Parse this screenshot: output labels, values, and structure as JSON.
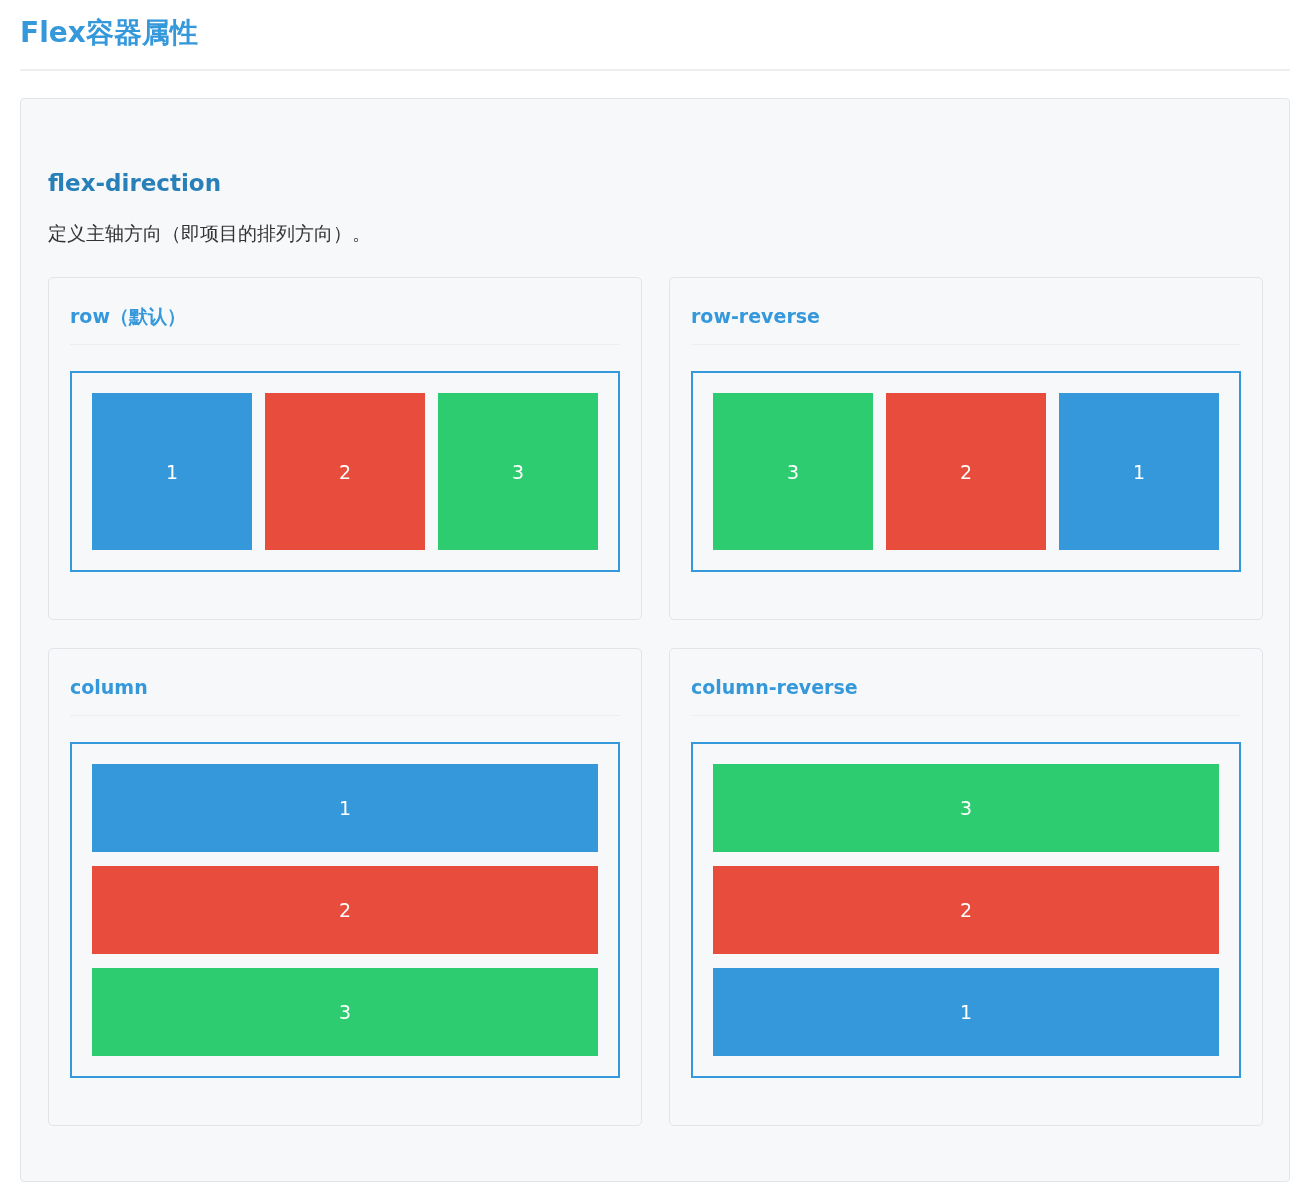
{
  "page_title": "Flex容器属性",
  "section": {
    "heading": "flex-direction",
    "description": "定义主轴方向（即项目的排列方向）。",
    "cards": [
      {
        "title": "row（默认）",
        "kind": "row",
        "items": [
          {
            "label": "1",
            "color": "#3498db"
          },
          {
            "label": "2",
            "color": "#e74c3c"
          },
          {
            "label": "3",
            "color": "#2ecc71"
          }
        ]
      },
      {
        "title": "row-reverse",
        "kind": "row-reverse",
        "items": [
          {
            "label": "3",
            "color": "#2ecc71"
          },
          {
            "label": "2",
            "color": "#e74c3c"
          },
          {
            "label": "1",
            "color": "#3498db"
          }
        ]
      },
      {
        "title": "column",
        "kind": "column",
        "items": [
          {
            "label": "1",
            "color": "#3498db"
          },
          {
            "label": "2",
            "color": "#e74c3c"
          },
          {
            "label": "3",
            "color": "#2ecc71"
          }
        ]
      },
      {
        "title": "column-reverse",
        "kind": "column-reverse",
        "items": [
          {
            "label": "3",
            "color": "#2ecc71"
          },
          {
            "label": "2",
            "color": "#e74c3c"
          },
          {
            "label": "1",
            "color": "#3498db"
          }
        ]
      }
    ]
  }
}
